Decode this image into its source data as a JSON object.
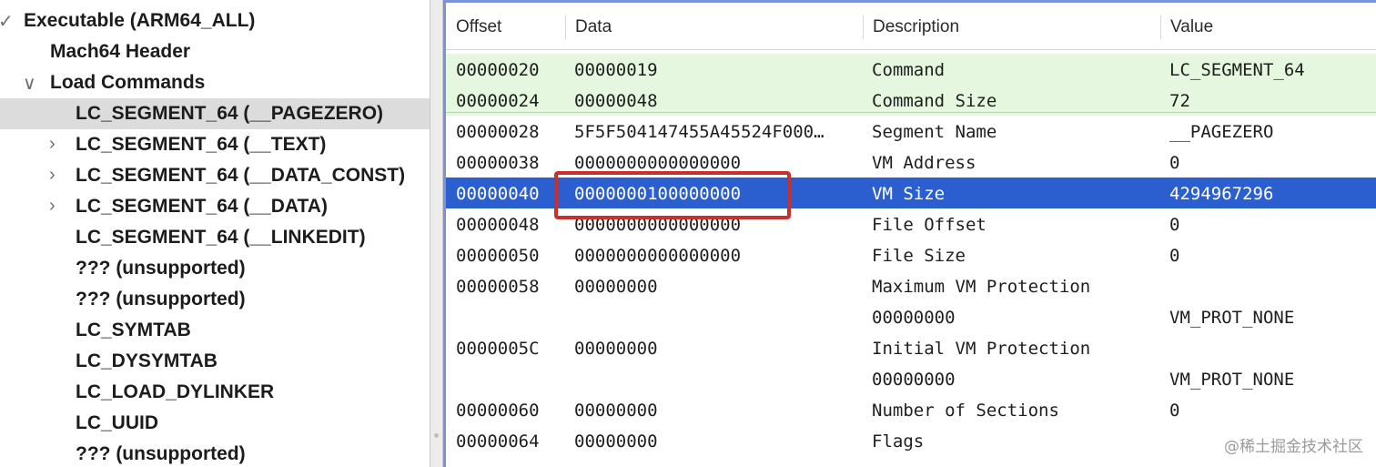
{
  "tree": {
    "items": [
      {
        "label": "Executable  (ARM64_ALL)",
        "chevron": "✓",
        "selected": false
      },
      {
        "label": "Mach64 Header",
        "chevron": "",
        "selected": false
      },
      {
        "label": "Load Commands",
        "chevron": "∨",
        "selected": false
      },
      {
        "label": "LC_SEGMENT_64 (__PAGEZERO)",
        "chevron": "",
        "selected": true
      },
      {
        "label": "LC_SEGMENT_64 (__TEXT)",
        "chevron": "›",
        "selected": false
      },
      {
        "label": "LC_SEGMENT_64 (__DATA_CONST)",
        "chevron": "›",
        "selected": false
      },
      {
        "label": "LC_SEGMENT_64 (__DATA)",
        "chevron": "›",
        "selected": false
      },
      {
        "label": "LC_SEGMENT_64 (__LINKEDIT)",
        "chevron": "",
        "selected": false
      },
      {
        "label": "??? (unsupported)",
        "chevron": "",
        "selected": false
      },
      {
        "label": "??? (unsupported)",
        "chevron": "",
        "selected": false
      },
      {
        "label": "LC_SYMTAB",
        "chevron": "",
        "selected": false
      },
      {
        "label": "LC_DYSYMTAB",
        "chevron": "",
        "selected": false
      },
      {
        "label": "LC_LOAD_DYLINKER",
        "chevron": "",
        "selected": false
      },
      {
        "label": "LC_UUID",
        "chevron": "",
        "selected": false
      },
      {
        "label": "??? (unsupported)",
        "chevron": "",
        "selected": false
      }
    ]
  },
  "table": {
    "columns": [
      "Offset",
      "Data",
      "Description",
      "Value"
    ],
    "rows": [
      {
        "offset": "00000020",
        "data": "00000019",
        "description": "Command",
        "value": "LC_SEGMENT_64",
        "style": "green"
      },
      {
        "offset": "00000024",
        "data": "00000048",
        "description": "Command Size",
        "value": "72",
        "style": "green"
      },
      {
        "offset": "00000028",
        "data": "5F5F504147455A45524F000…",
        "description": "Segment Name",
        "value": "__PAGEZERO",
        "style": ""
      },
      {
        "offset": "00000038",
        "data": "0000000000000000",
        "description": "VM Address",
        "value": "0",
        "style": ""
      },
      {
        "offset": "00000040",
        "data": "0000000100000000",
        "description": "VM Size",
        "value": "4294967296",
        "style": "selected"
      },
      {
        "offset": "00000048",
        "data": "0000000000000000",
        "description": "File Offset",
        "value": "0",
        "style": ""
      },
      {
        "offset": "00000050",
        "data": "0000000000000000",
        "description": "File Size",
        "value": "0",
        "style": ""
      },
      {
        "offset": "00000058",
        "data": "00000000",
        "description": "Maximum VM Protection",
        "value": "",
        "style": ""
      },
      {
        "offset": "",
        "data": "",
        "description": "00000000",
        "value": "VM_PROT_NONE",
        "style": ""
      },
      {
        "offset": "0000005C",
        "data": "00000000",
        "description": "Initial VM Protection",
        "value": "",
        "style": ""
      },
      {
        "offset": "",
        "data": "",
        "description": "00000000",
        "value": "VM_PROT_NONE",
        "style": ""
      },
      {
        "offset": "00000060",
        "data": "00000000",
        "description": "Number of Sections",
        "value": "0",
        "style": ""
      },
      {
        "offset": "00000064",
        "data": "00000000",
        "description": "Flags",
        "value": "",
        "style": ""
      }
    ]
  },
  "watermark": "@稀土掘金技术社区",
  "colors": {
    "selection": "#2b5fd0",
    "green_rows": "#e6f7df",
    "highlight_box": "#c9302c",
    "tree_selected": "#dcdcdc"
  }
}
